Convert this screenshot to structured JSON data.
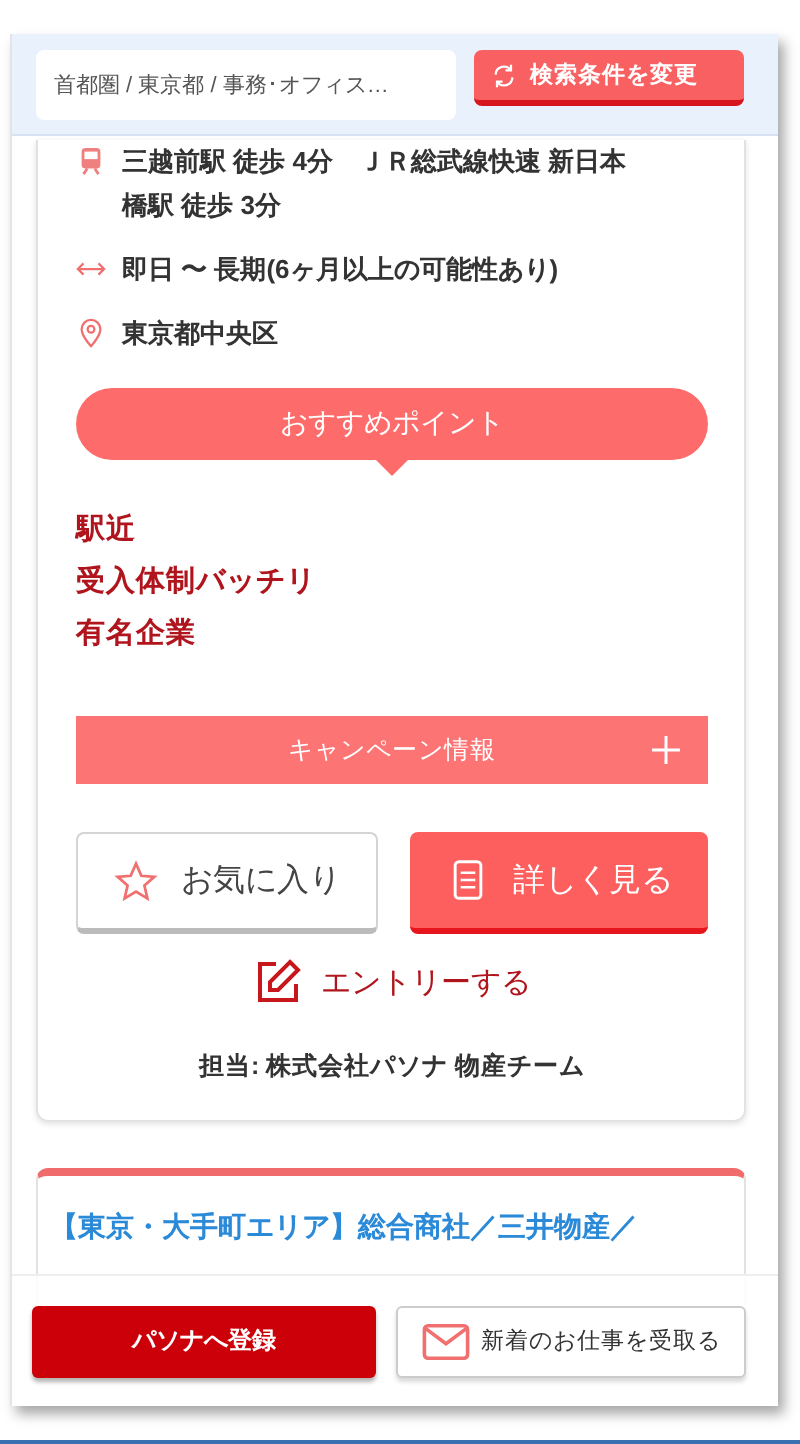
{
  "search": {
    "value": "首都圏 / 東京都 / 事務･オフィス…"
  },
  "change_button": "検索条件を変更",
  "job": {
    "details": [
      {
        "kind": "train",
        "text": "三越前駅 徒歩 4分　ＪＲ総武線快速 新日本橋駅 徒歩 3分"
      },
      {
        "kind": "period",
        "text": "即日 〜 長期(6ヶ月以上の可能性あり)"
      },
      {
        "kind": "location",
        "text": "東京都中央区"
      }
    ],
    "recommend_heading": "おすすめポイント",
    "points": [
      "駅近",
      "受入体制バッチリ",
      "有名企業"
    ],
    "campaign": {
      "label": "キャンペーン情報",
      "expanded": false
    },
    "favorite_button": "お気に入り",
    "detail_button": "詳しく見る",
    "entry_link": "エントリーする",
    "contact": "担当: 株式会社パソナ 物産チーム"
  },
  "next_job": {
    "title": "【東京・大手町エリア】総合商社／三井物産／"
  },
  "bottom_bar": {
    "register_button": "パソナへ登録",
    "notify_button": "新着のお仕事を受取る"
  }
}
